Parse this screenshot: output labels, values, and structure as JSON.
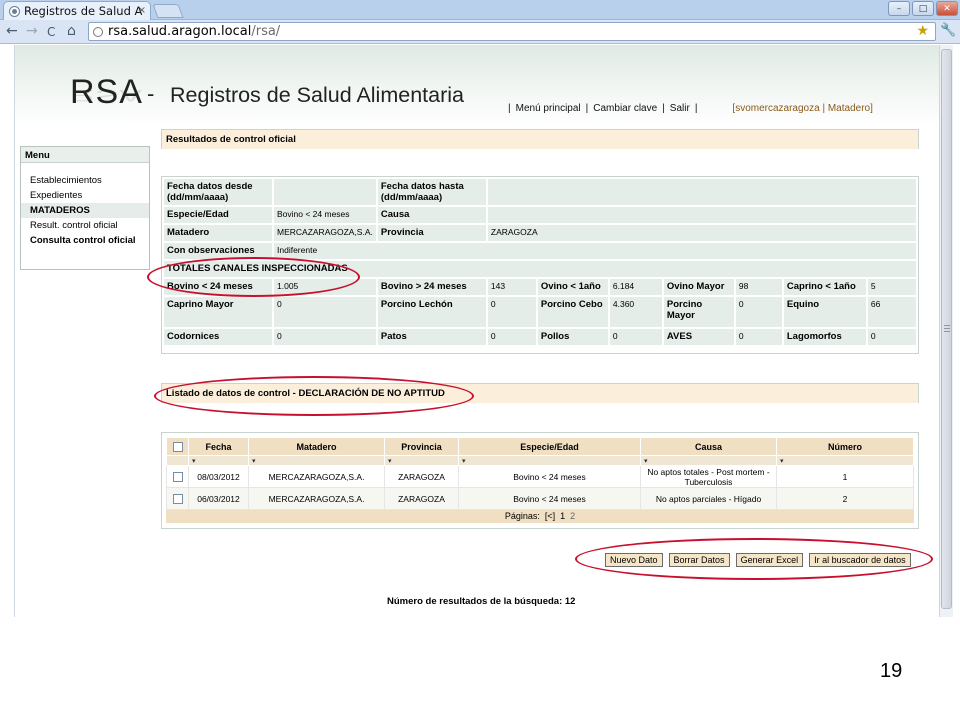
{
  "browser": {
    "tab_title": "Registros de Salud A",
    "tab_close": "×",
    "url_host": "rsa.salud.aragon.local",
    "url_path": "/rsa/",
    "back_icon": "←",
    "forward_icon": "→",
    "reload_icon": "C",
    "home_icon": "⌂",
    "star_icon": "★",
    "wrench_icon": "🔧",
    "min_icon": "–",
    "max_icon": "□",
    "close_icon": "✕"
  },
  "header": {
    "logo": "RSA",
    "dash": "-",
    "subtitle": "Registros de Salud Alimentaria",
    "nav": [
      "Menú principal",
      "Cambiar clave",
      "Salir"
    ],
    "user": "[svomercazaragoza | Matadero]"
  },
  "menu": {
    "title": "Menu",
    "items": [
      {
        "label": "Establecimientos"
      },
      {
        "label": "Expedientes"
      },
      {
        "label": "MATADEROS"
      },
      {
        "label": "Result. control oficial"
      },
      {
        "label": "Consulta control oficial"
      }
    ]
  },
  "results_panel": {
    "title": "Resultados de control oficial"
  },
  "form": {
    "fecha_desde_label": "Fecha datos desde (dd/mm/aaaa)",
    "fecha_hasta_label": "Fecha datos hasta (dd/mm/aaaa)",
    "especie_label": "Especie/Edad",
    "especie_value": "Bovino < 24 meses",
    "causa_label": "Causa",
    "matadero_label": "Matadero",
    "matadero_value": "MERCAZARAGOZA,S.A.",
    "provincia_label": "Provincia",
    "provincia_value": "ZARAGOZA",
    "observaciones_label": "Con observaciones",
    "observaciones_value": "Indiferente",
    "totales_title": "TOTALES CANALES INSPECCIONADAS",
    "totales": [
      [
        {
          "label": "Bovino < 24 meses",
          "value": "1.005"
        },
        {
          "label": "Bovino > 24 meses",
          "value": "143"
        },
        {
          "label": "Ovino < 1año",
          "value": "6.184"
        },
        {
          "label": "Ovino Mayor",
          "value": "98"
        },
        {
          "label": "Caprino < 1año",
          "value": "5"
        }
      ],
      [
        {
          "label": "Caprino Mayor",
          "value": "0"
        },
        {
          "label": "Porcino Lechón",
          "value": "0"
        },
        {
          "label": "Porcino Cebo",
          "value": "4.360"
        },
        {
          "label": "Porcino Mayor",
          "value": "0"
        },
        {
          "label": "Equino",
          "value": "66"
        }
      ],
      [
        {
          "label": "Codornices",
          "value": "0"
        },
        {
          "label": "Patos",
          "value": "0"
        },
        {
          "label": "Pollos",
          "value": "0"
        },
        {
          "label": "AVES",
          "value": "0"
        },
        {
          "label": "Lagomorfos",
          "value": "0"
        }
      ]
    ]
  },
  "listado_panel": {
    "title": "Listado de datos de control - DECLARACIÓN DE NO APTITUD"
  },
  "grid": {
    "columns": [
      "Fecha",
      "Matadero",
      "Provincia",
      "Especie/Edad",
      "Causa",
      "Número"
    ],
    "rows": [
      [
        "08/03/2012",
        "MERCAZARAGOZA,S.A.",
        "ZARAGOZA",
        "Bovino < 24 meses",
        "No aptos totales - Post mortem - Tuberculosis",
        "1"
      ],
      [
        "06/03/2012",
        "MERCAZARAGOZA,S.A.",
        "ZARAGOZA",
        "Bovino < 24 meses",
        "No aptos parciales - Hígado",
        "2"
      ]
    ],
    "filter_icon": "▾",
    "pager_label": "Páginas:",
    "pager_first": "[<]",
    "pager_current": "1",
    "pager_next": "2"
  },
  "actions": {
    "nuevo": "Nuevo Dato",
    "borrar": "Borrar Datos",
    "excel": "Generar Excel",
    "buscador": "Ir al buscador de datos"
  },
  "result_count": "Número de resultados de la búsqueda: 12",
  "slide_number": "19"
}
